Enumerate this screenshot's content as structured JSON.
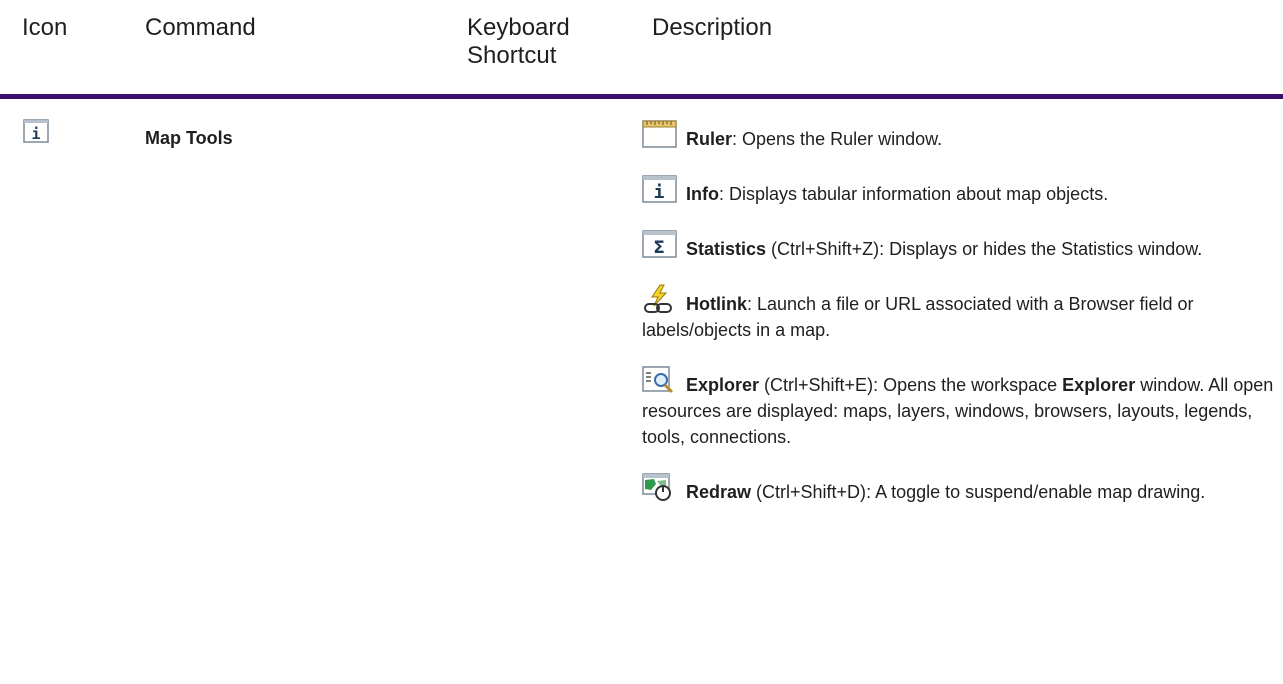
{
  "header": {
    "icon": "Icon",
    "command": "Command",
    "shortcut": "Keyboard Shortcut",
    "description": "Description"
  },
  "colors": {
    "header_rule": "#3b0f6d",
    "text": "#1f1f1f"
  },
  "row": {
    "icon": "info-window-icon",
    "command": "Map Tools",
    "shortcut": "",
    "items": [
      {
        "icon": "ruler-icon",
        "name": "Ruler",
        "shortcut": "",
        "rest": ": Opens the Ruler window."
      },
      {
        "icon": "info-icon",
        "name": "Info",
        "shortcut": "",
        "rest": ": Displays tabular information about map objects."
      },
      {
        "icon": "statistics-icon",
        "name": "Statistics",
        "shortcut": " (Ctrl+Shift+Z)",
        "rest": ": Displays or hides the Statistics window."
      },
      {
        "icon": "hotlink-icon",
        "name": "Hotlink",
        "shortcut": "",
        "rest": ": Launch a file or URL associated with a Browser field or labels/objects in a map."
      },
      {
        "icon": "explorer-icon",
        "name": "Explorer",
        "shortcut": " (Ctrl+Shift+E)",
        "rest_pre": ": Opens the workspace ",
        "rest_bold": "Explorer",
        "rest": " window. All open resources are displayed: maps, layers, windows, browsers, layouts, legends, tools, connections."
      },
      {
        "icon": "redraw-icon",
        "name": "Redraw",
        "shortcut": " (Ctrl+Shift+D)",
        "rest": ": A toggle to suspend/enable map drawing."
      }
    ]
  }
}
